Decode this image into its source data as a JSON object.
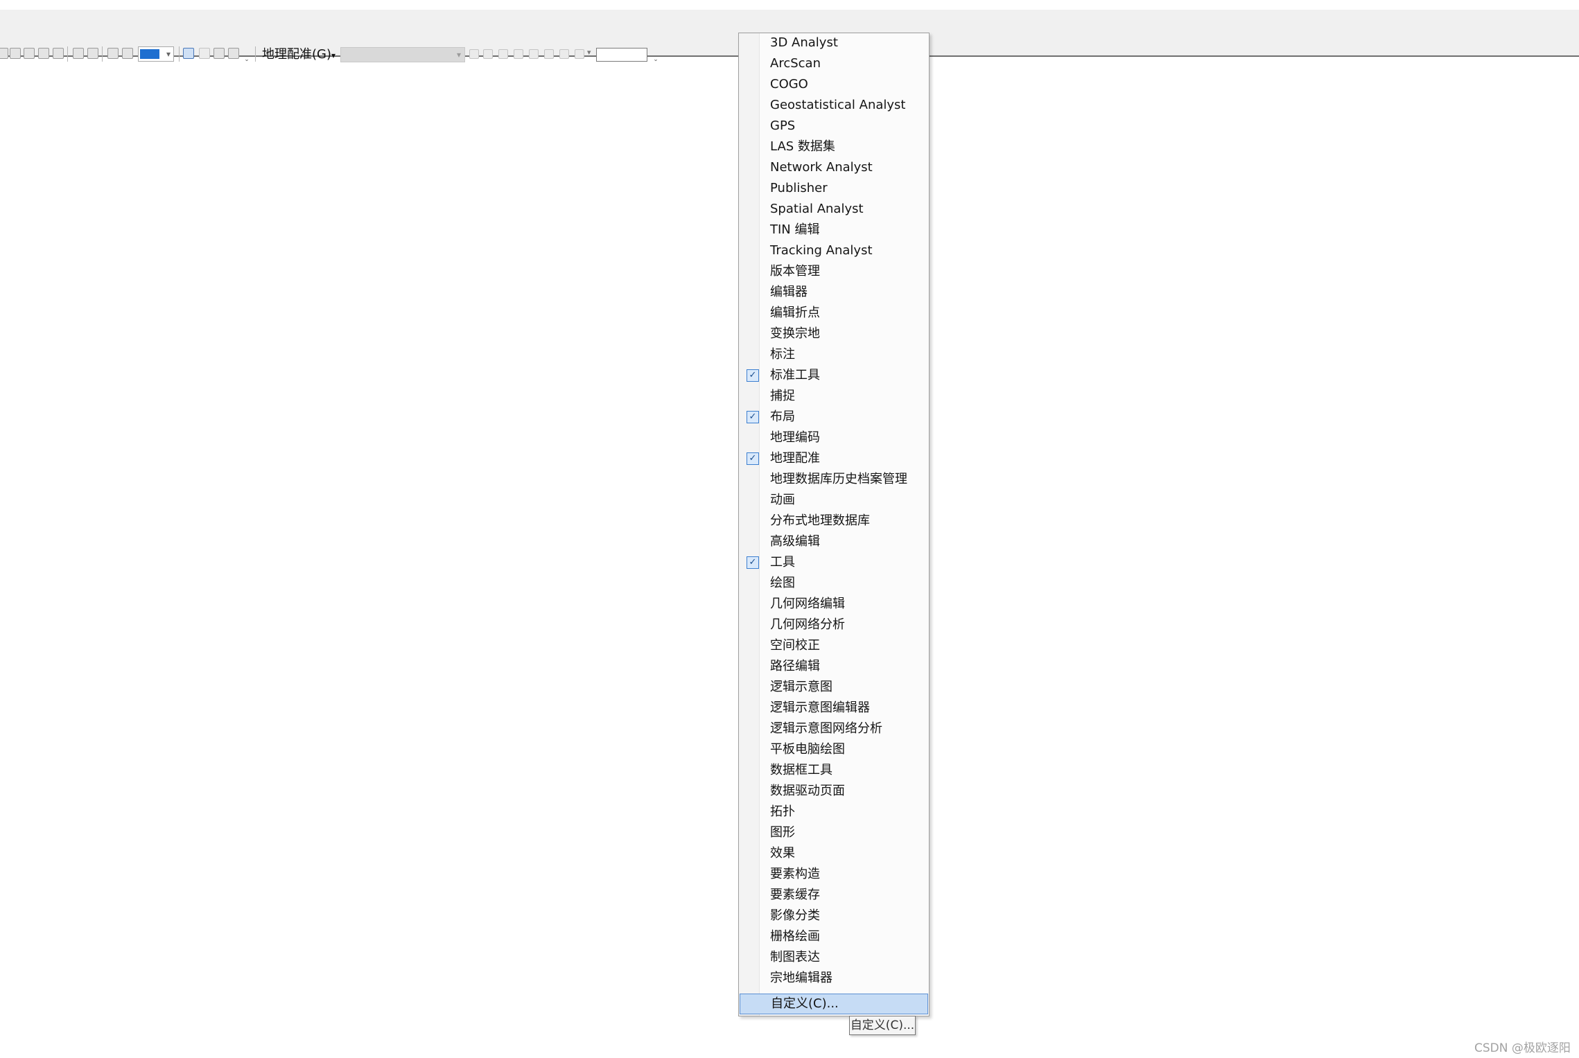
{
  "toolbar": {
    "georeferencing_label": "地理配准(G)",
    "georeferencing_arrow": "▾",
    "scale_arrow": "▾",
    "layer_combo_arrow": "▾",
    "rotate_arrow": "▾",
    "grip_glyph": "⌄"
  },
  "menu": {
    "check_glyph": "✓",
    "items": [
      {
        "label": "3D Analyst",
        "checked": false
      },
      {
        "label": "ArcScan",
        "checked": false
      },
      {
        "label": "COGO",
        "checked": false
      },
      {
        "label": "Geostatistical Analyst",
        "checked": false
      },
      {
        "label": "GPS",
        "checked": false
      },
      {
        "label": "LAS 数据集",
        "checked": false
      },
      {
        "label": "Network Analyst",
        "checked": false
      },
      {
        "label": "Publisher",
        "checked": false
      },
      {
        "label": "Spatial Analyst",
        "checked": false
      },
      {
        "label": "TIN 编辑",
        "checked": false
      },
      {
        "label": "Tracking Analyst",
        "checked": false
      },
      {
        "label": "版本管理",
        "checked": false
      },
      {
        "label": "编辑器",
        "checked": false
      },
      {
        "label": "编辑折点",
        "checked": false
      },
      {
        "label": "变换宗地",
        "checked": false
      },
      {
        "label": "标注",
        "checked": false
      },
      {
        "label": "标准工具",
        "checked": true
      },
      {
        "label": "捕捉",
        "checked": false
      },
      {
        "label": "布局",
        "checked": true
      },
      {
        "label": "地理编码",
        "checked": false
      },
      {
        "label": "地理配准",
        "checked": true
      },
      {
        "label": "地理数据库历史档案管理",
        "checked": false
      },
      {
        "label": "动画",
        "checked": false
      },
      {
        "label": "分布式地理数据库",
        "checked": false
      },
      {
        "label": "高级编辑",
        "checked": false
      },
      {
        "label": "工具",
        "checked": true
      },
      {
        "label": "绘图",
        "checked": false
      },
      {
        "label": "几何网络编辑",
        "checked": false
      },
      {
        "label": "几何网络分析",
        "checked": false
      },
      {
        "label": "空间校正",
        "checked": false
      },
      {
        "label": "路径编辑",
        "checked": false
      },
      {
        "label": "逻辑示意图",
        "checked": false
      },
      {
        "label": "逻辑示意图编辑器",
        "checked": false
      },
      {
        "label": "逻辑示意图网络分析",
        "checked": false
      },
      {
        "label": "平板电脑绘图",
        "checked": false
      },
      {
        "label": "数据框工具",
        "checked": false
      },
      {
        "label": "数据驱动页面",
        "checked": false
      },
      {
        "label": "拓扑",
        "checked": false
      },
      {
        "label": "图形",
        "checked": false
      },
      {
        "label": "效果",
        "checked": false
      },
      {
        "label": "要素构造",
        "checked": false
      },
      {
        "label": "要素缓存",
        "checked": false
      },
      {
        "label": "影像分类",
        "checked": false
      },
      {
        "label": "栅格绘画",
        "checked": false
      },
      {
        "label": "制图表达",
        "checked": false
      },
      {
        "label": "宗地编辑器",
        "checked": false
      }
    ],
    "customize_label": "自定义(C)..."
  },
  "tooltip": {
    "text": "自定义(C)..."
  },
  "watermark": {
    "text": "CSDN @极欧逐阳"
  }
}
